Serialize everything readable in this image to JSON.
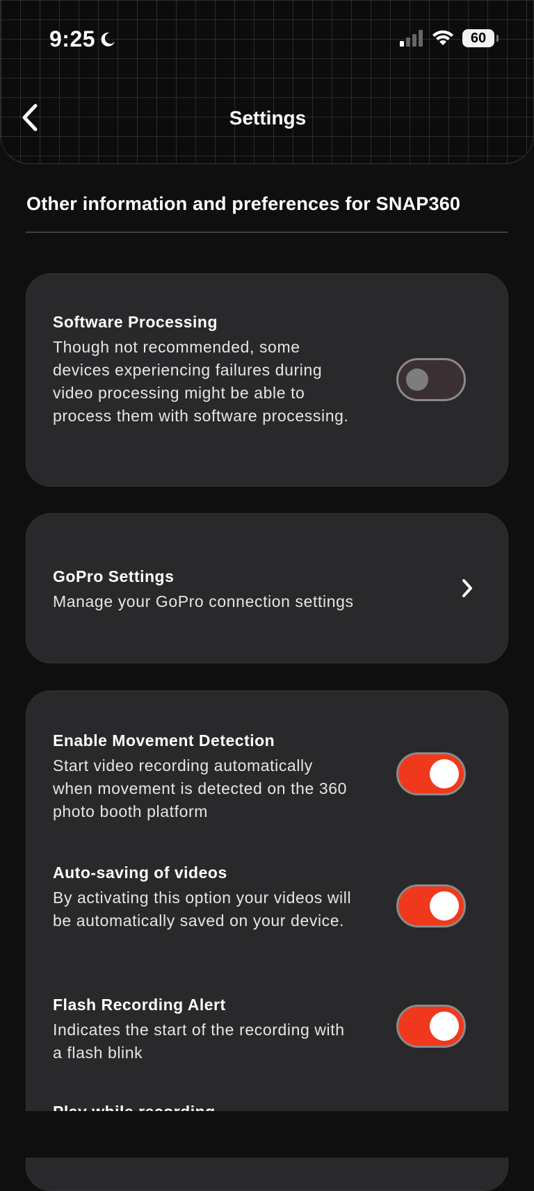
{
  "status_bar": {
    "time": "9:25",
    "battery": "60"
  },
  "header": {
    "title": "Settings"
  },
  "section_title": "Other information and preferences for SNAP360",
  "settings": {
    "software_processing": {
      "title": "Software Processing",
      "description": "Though not recommended, some devices experiencing failures during video processing might be able to process them with software processing.",
      "enabled": false
    },
    "gopro": {
      "title": "GoPro Settings",
      "description": "Manage your GoPro connection settings"
    },
    "movement_detection": {
      "title": "Enable Movement Detection",
      "description": "Start video recording automatically when movement is detected on the 360 photo booth platform",
      "enabled": true
    },
    "auto_saving": {
      "title": "Auto-saving of videos",
      "description": "By activating this option your videos will be automatically saved on your device.",
      "enabled": true
    },
    "flash_alert": {
      "title": "Flash Recording Alert",
      "description": "Indicates the start of the recording with a flash blink",
      "enabled": true
    },
    "play_while_recording": {
      "title": "Play while recording"
    }
  },
  "colors": {
    "accent": "#f0391c",
    "card": "#29292c",
    "background": "#0f0f10"
  }
}
